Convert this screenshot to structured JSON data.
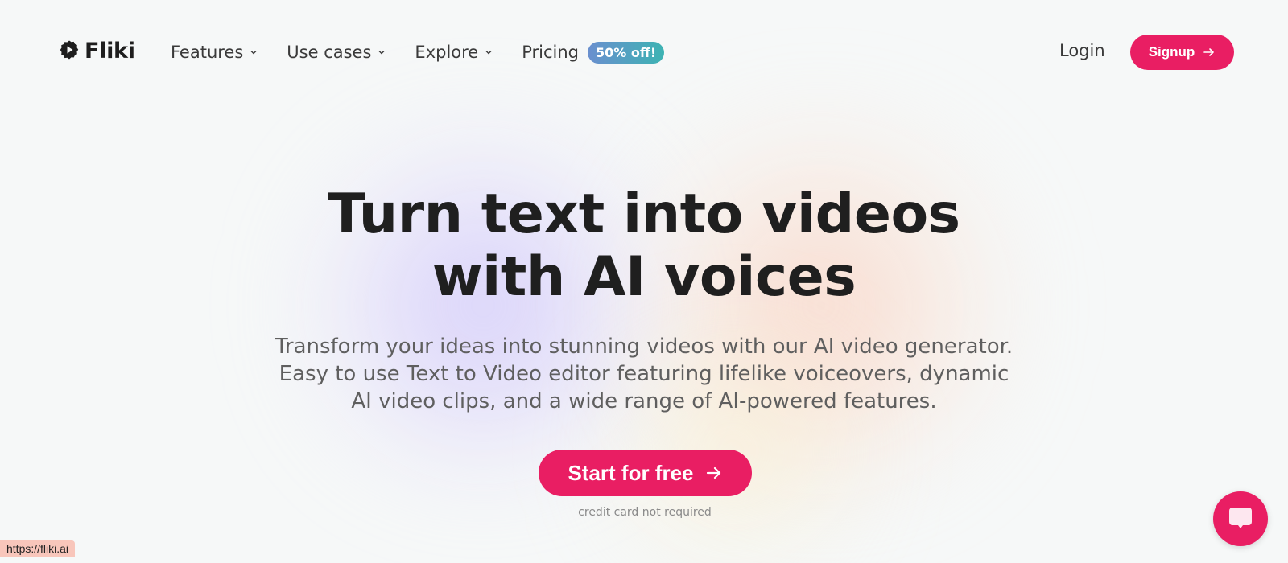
{
  "brand": {
    "name": "Fliki",
    "logo_icon": "play-gear-icon"
  },
  "nav": {
    "items": [
      {
        "label": "Features",
        "icon": "chevron-down-icon"
      },
      {
        "label": "Use cases",
        "icon": "chevron-down-icon"
      },
      {
        "label": "Explore",
        "icon": "chevron-down-icon"
      }
    ],
    "pricing_label": "Pricing",
    "pricing_badge": "50% off!",
    "login_label": "Login",
    "signup_label": "Signup",
    "signup_icon": "arrow-right-icon"
  },
  "hero": {
    "title_line1": "Turn text into videos",
    "title_line2": "with AI voices",
    "subtitle": "Transform your ideas into stunning videos with our AI video generator. Easy to use Text to Video editor featuring lifelike voiceovers, dynamic AI video clips, and a wide range of AI-powered features.",
    "cta_label": "Start for free",
    "cta_icon": "arrow-right-icon",
    "cta_note": "credit card not required"
  },
  "chat_widget": {
    "icon": "chat-bubble-icon"
  },
  "status_bar": {
    "url": "https://fliki.ai"
  },
  "colors": {
    "accent": "#e91e63",
    "badge_start": "#6a8fcf",
    "badge_end": "#3db3b3",
    "background": "#f6f8f8"
  }
}
